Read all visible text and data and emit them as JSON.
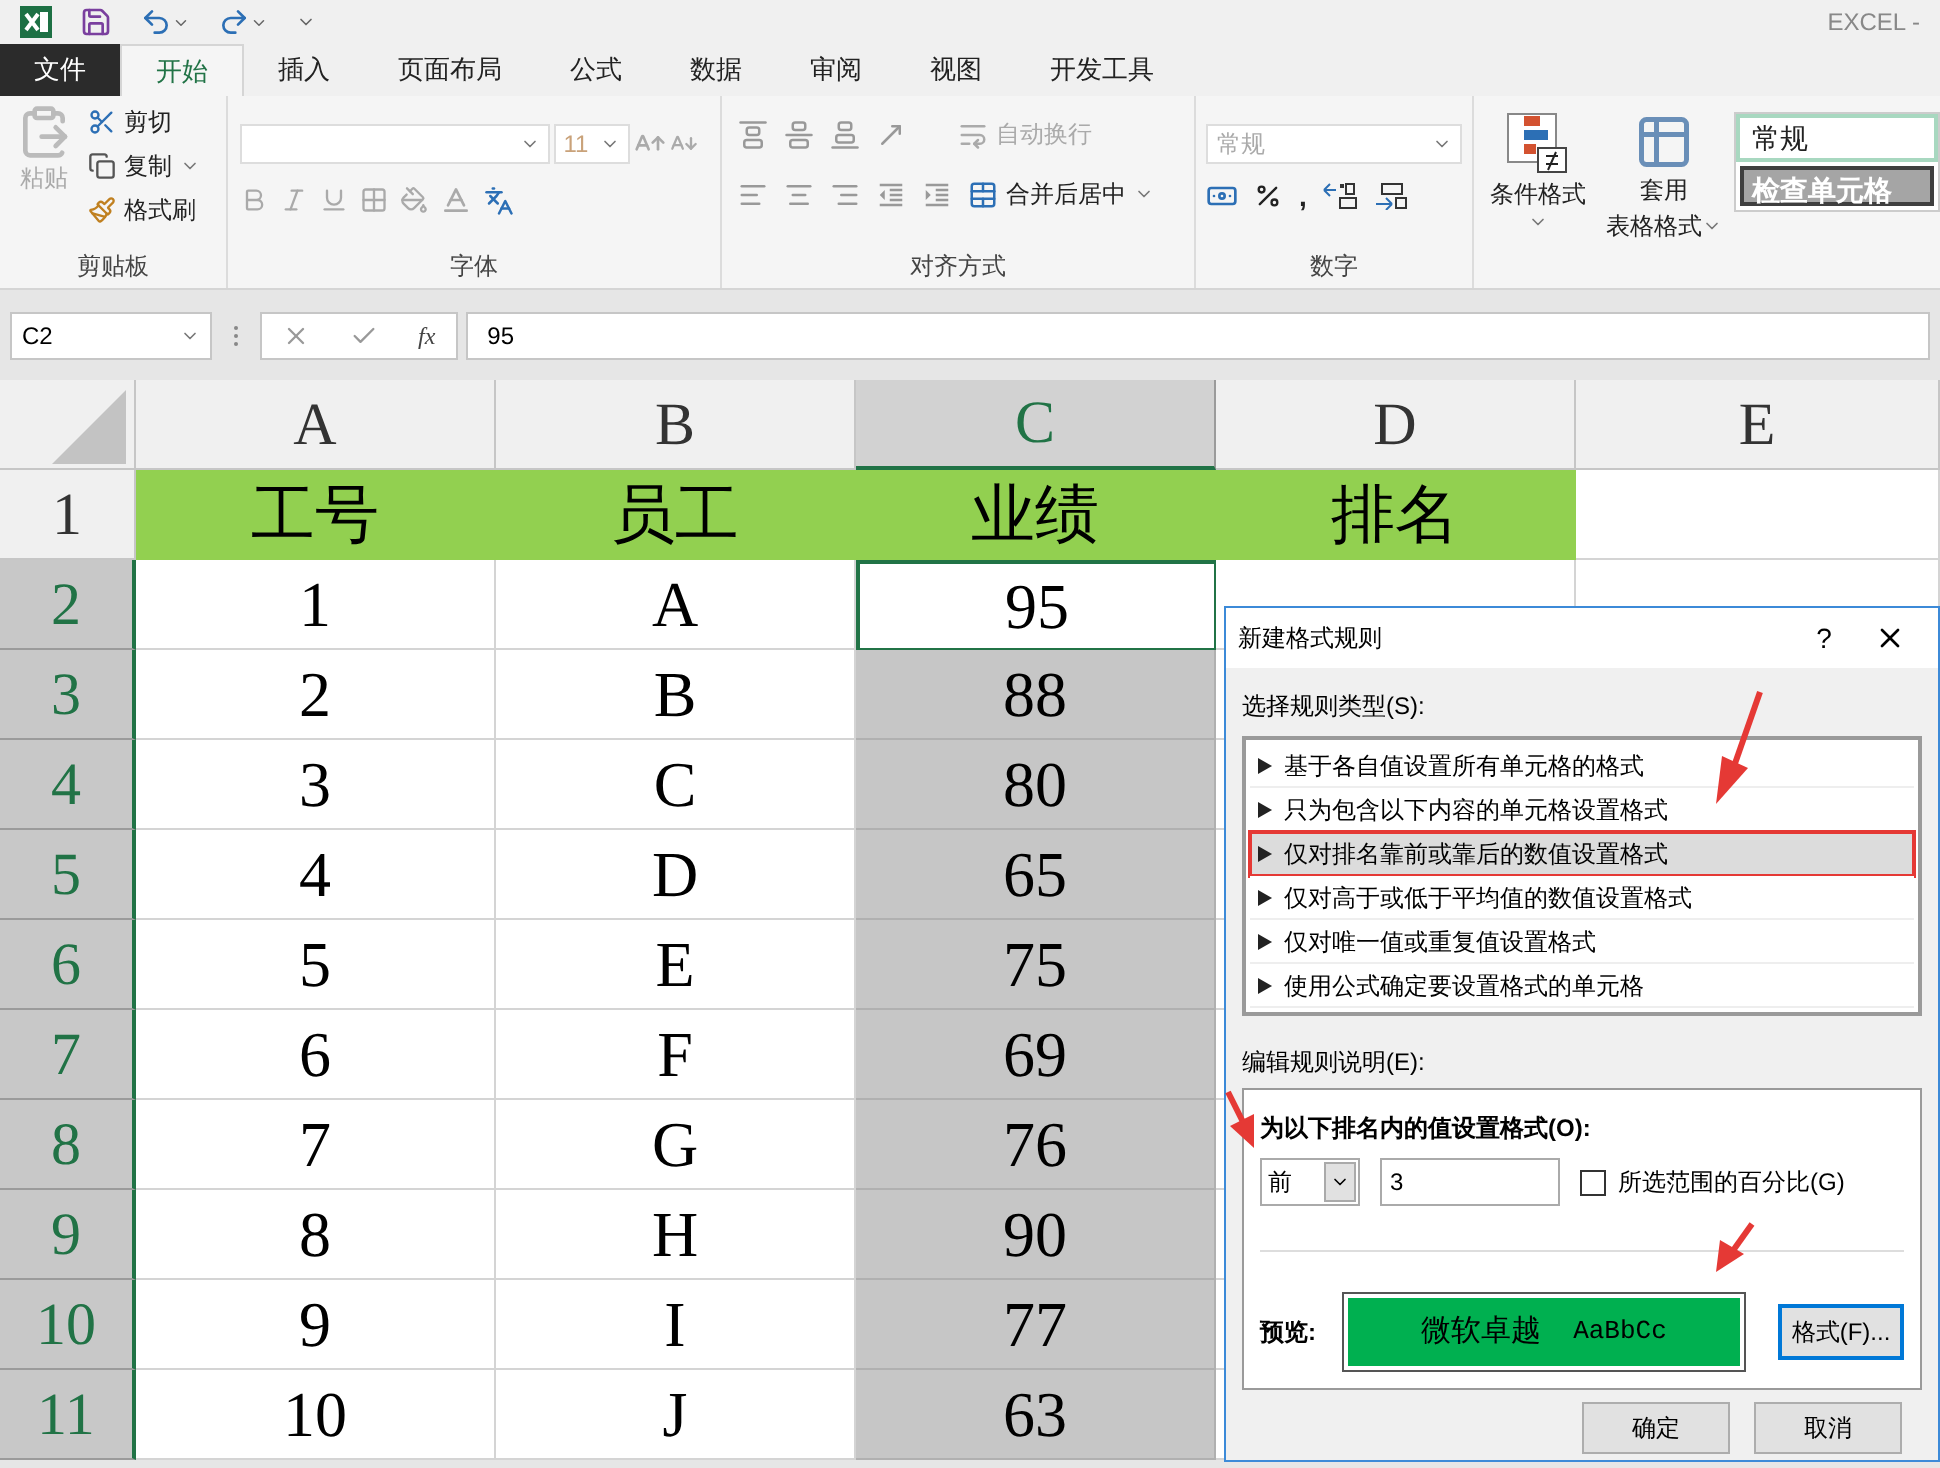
{
  "window": {
    "title": "EXCEL -"
  },
  "ribbon_tabs": [
    {
      "label": "文件",
      "kind": "file",
      "selected": false
    },
    {
      "label": "开始",
      "kind": "tab",
      "selected": true
    },
    {
      "label": "插入",
      "kind": "tab",
      "selected": false
    },
    {
      "label": "页面布局",
      "kind": "tab",
      "selected": false
    },
    {
      "label": "公式",
      "kind": "tab",
      "selected": false
    },
    {
      "label": "数据",
      "kind": "tab",
      "selected": false
    },
    {
      "label": "审阅",
      "kind": "tab",
      "selected": false
    },
    {
      "label": "视图",
      "kind": "tab",
      "selected": false
    },
    {
      "label": "开发工具",
      "kind": "tab",
      "selected": false
    }
  ],
  "ribbon": {
    "clipboard": {
      "paste": "粘贴",
      "cut": "剪切",
      "copy": "复制",
      "format_painter": "格式刷",
      "label": "剪贴板"
    },
    "font": {
      "size": "11",
      "label": "字体"
    },
    "alignment": {
      "wrap": "自动换行",
      "merge": "合并后居中",
      "label": "对齐方式"
    },
    "number": {
      "format": "常规",
      "comma": ",",
      "label": "数字"
    },
    "styles": {
      "conditional": "条件格式",
      "table_format_1": "套用",
      "table_format_2": "表格格式",
      "style_normal": "常规",
      "style_check": "检查单元格"
    }
  },
  "formula_bar": {
    "name_box": "C2",
    "fx": "fx",
    "value": "95"
  },
  "sheet": {
    "columns": [
      {
        "label": "A",
        "selected": false
      },
      {
        "label": "B",
        "selected": false
      },
      {
        "label": "C",
        "selected": true
      },
      {
        "label": "D",
        "selected": false
      },
      {
        "label": "E",
        "selected": false
      }
    ],
    "rows": [
      {
        "header": "1",
        "selected": false,
        "cells": [
          {
            "text": "工号",
            "kind": "title"
          },
          {
            "text": "员工",
            "kind": "title"
          },
          {
            "text": "业绩",
            "kind": "title"
          },
          {
            "text": "排名",
            "kind": "title"
          }
        ]
      },
      {
        "header": "2",
        "selected": true,
        "cells": [
          {
            "text": "1"
          },
          {
            "text": "A"
          },
          {
            "text": "95",
            "active": true
          }
        ]
      },
      {
        "header": "3",
        "selected": true,
        "cells": [
          {
            "text": "2"
          },
          {
            "text": "B"
          },
          {
            "text": "88",
            "selected": true
          }
        ]
      },
      {
        "header": "4",
        "selected": true,
        "cells": [
          {
            "text": "3"
          },
          {
            "text": "C"
          },
          {
            "text": "80",
            "selected": true
          }
        ]
      },
      {
        "header": "5",
        "selected": true,
        "cells": [
          {
            "text": "4"
          },
          {
            "text": "D"
          },
          {
            "text": "65",
            "selected": true
          }
        ]
      },
      {
        "header": "6",
        "selected": true,
        "cells": [
          {
            "text": "5"
          },
          {
            "text": "E"
          },
          {
            "text": "75",
            "selected": true
          }
        ]
      },
      {
        "header": "7",
        "selected": true,
        "cells": [
          {
            "text": "6"
          },
          {
            "text": "F"
          },
          {
            "text": "69",
            "selected": true
          }
        ]
      },
      {
        "header": "8",
        "selected": true,
        "cells": [
          {
            "text": "7"
          },
          {
            "text": "G"
          },
          {
            "text": "76",
            "selected": true
          }
        ]
      },
      {
        "header": "9",
        "selected": true,
        "cells": [
          {
            "text": "8"
          },
          {
            "text": "H"
          },
          {
            "text": "90",
            "selected": true
          }
        ]
      },
      {
        "header": "10",
        "selected": true,
        "cells": [
          {
            "text": "9"
          },
          {
            "text": "I"
          },
          {
            "text": "77",
            "selected": true
          }
        ]
      },
      {
        "header": "11",
        "selected": true,
        "cells": [
          {
            "text": "10"
          },
          {
            "text": "J"
          },
          {
            "text": "63",
            "selected": true
          }
        ]
      }
    ]
  },
  "dialog": {
    "title": "新建格式规则",
    "help": "?",
    "rule_type_label": "选择规则类型(S):",
    "rules": [
      {
        "label": "基于各自值设置所有单元格的格式",
        "selected": false
      },
      {
        "label": "只为包含以下内容的单元格设置格式",
        "selected": false
      },
      {
        "label": "仅对排名靠前或靠后的数值设置格式",
        "selected": true
      },
      {
        "label": "仅对高于或低于平均值的数值设置格式",
        "selected": false
      },
      {
        "label": "仅对唯一值或重复值设置格式",
        "selected": false
      },
      {
        "label": "使用公式确定要设置格式的单元格",
        "selected": false
      }
    ],
    "description_label": "编辑规则说明(E):",
    "rank_label": "为以下排名内的值设置格式(O):",
    "direction": "前",
    "count": "3",
    "percent": {
      "label": "所选范围的百分比(G)",
      "checked": false
    },
    "preview_label": "预览:",
    "preview_cn": "微软卓越",
    "preview_en": "AaBbCc",
    "format_button": "格式(F)...",
    "ok": "确定",
    "cancel": "取消"
  }
}
